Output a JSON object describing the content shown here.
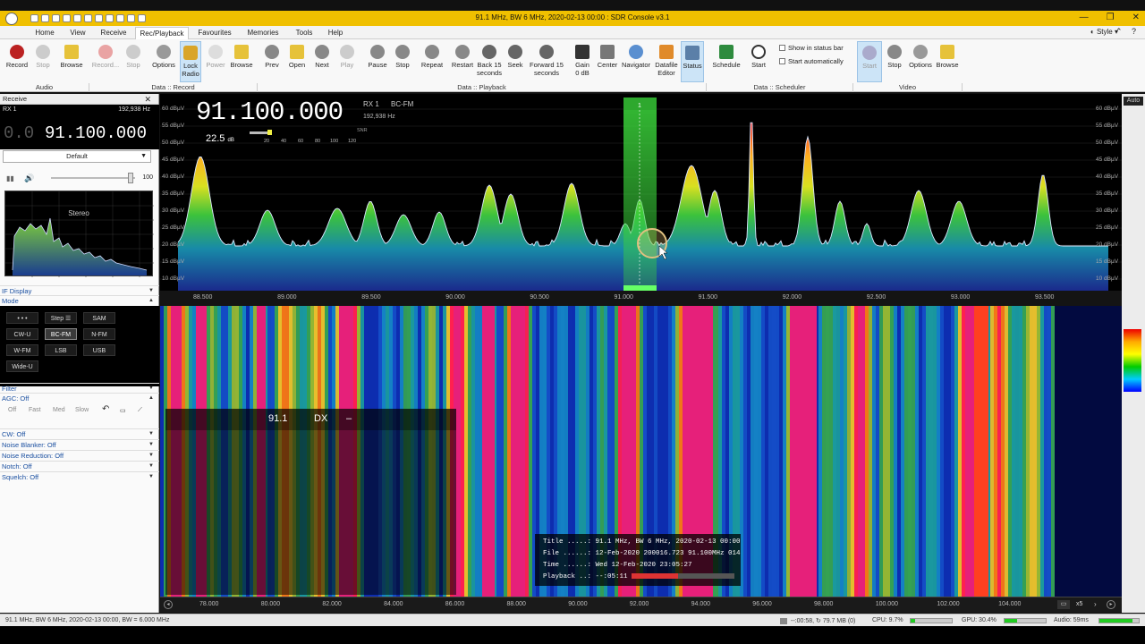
{
  "window": {
    "title": "91.1 MHz, BW 6 MHz, 2020-02-13 00:00 : SDR Console v3.1",
    "controls": [
      "—",
      "❐",
      "✕"
    ]
  },
  "menu": {
    "tabs": [
      "Home",
      "View",
      "Receive",
      "Rec/Playback",
      "Favourites",
      "Memories",
      "Tools",
      "Help"
    ],
    "active": "Rec/Playback",
    "style": "Style"
  },
  "ribbon": {
    "audio": {
      "record": "Record",
      "stop": "Stop",
      "browse": "Browse",
      "group": "Audio"
    },
    "data_record": {
      "record": "Record...",
      "stop": "Stop",
      "options": "Options",
      "lock_radio_1": "Lock",
      "lock_radio_2": "Radio",
      "power": "Power",
      "browse": "Browse",
      "group": "Data :: Record"
    },
    "data_playback": {
      "prev": "Prev",
      "open": "Open",
      "next": "Next",
      "play": "Play",
      "pause": "Pause",
      "stop": "Stop",
      "repeat": "Repeat",
      "restart": "Restart",
      "back15_1": "Back 15",
      "back15_2": "seconds",
      "seek": "Seek",
      "fwd15_1": "Forward 15",
      "fwd15_2": "seconds",
      "gain_1": "Gain",
      "gain_2": "0 dB",
      "center": "Center",
      "navigator": "Navigator",
      "datafile_1": "Datafile",
      "datafile_2": "Editor",
      "status": "Status",
      "group": "Data :: Playback"
    },
    "data_scheduler": {
      "schedule": "Schedule",
      "start": "Start",
      "show_status": "Show in status bar",
      "start_auto": "Start automatically",
      "group": "Data :: Scheduler"
    },
    "video": {
      "start": "Start",
      "stop": "Stop",
      "options": "Options",
      "browse": "Browse",
      "group": "Video"
    }
  },
  "left": {
    "receive": "Receive",
    "rx": "RX 1",
    "bw": "192,938 Hz",
    "freq_dim": "0.0",
    "freq": "91.100.000",
    "preset": "Default",
    "volume": "100",
    "stereo": "Stereo",
    "if_display": "IF Display",
    "mode": "Mode",
    "modes": [
      "• • •",
      "Step ☰",
      "SAM",
      "CW-U",
      "BC-FM",
      "N-FM",
      "W-FM",
      "LSB",
      "USB",
      "Wide-U"
    ],
    "active_mode": "BC-FM",
    "filter": "Filter",
    "agc": "AGC: Off",
    "agc_opts": [
      "Off",
      "Fast",
      "Med",
      "Slow"
    ],
    "cw": "CW: Off",
    "nb": "Noise Blanker: Off",
    "nr": "Noise Reduction: Off",
    "notch": "Notch: Off",
    "squelch": "Squelch: Off"
  },
  "spectrum": {
    "freq": "91.100.000",
    "rx": "RX 1",
    "mode": "BC-FM",
    "bw": "192,938 Hz",
    "snr_value": "22.5",
    "snr_unit": "dB",
    "snr_label": "SNR",
    "snr_ticks": [
      "20",
      "40",
      "60",
      "80",
      "100",
      "120"
    ],
    "channel_marker": "1",
    "auto": "Auto",
    "ylabels": [
      "60 dBµV",
      "55 dBµV",
      "50 dBµV",
      "45 dBµV",
      "40 dBµV",
      "35 dBµV",
      "30 dBµV",
      "25 dBµV",
      "20 dBµV",
      "15 dBµV",
      "10 dBµV"
    ],
    "ylabels_right": [
      "60 dBµV",
      "55 dBµV",
      "50 dBµV",
      "45 dBµV",
      "40 dBµV",
      "35 dBµV",
      "30 dBµV",
      "25 dBµV",
      "20 dBµV",
      "15 dBµV",
      "10 dBµV"
    ],
    "xlabels": [
      "88.500",
      "89.000",
      "89.500",
      "90.000",
      "90.500",
      "91.000",
      "91.500",
      "92.000",
      "92.500",
      "93.000",
      "93.500"
    ]
  },
  "waterfall": {
    "dx_freq": "91.1",
    "dx_label": "DX",
    "dx_dash": "–",
    "info": {
      "title": "Title .....: 91.1 MHz, BW 6 MHz, 2020-02-13 00:00",
      "file": "File ......: 12-Feb-2020 200016.723 91.100MHz 014",
      "time": "Time ......: Wed 12-Feb-2020 23:05:27",
      "playback": "Playback ..: --:05:11",
      "progress": 0.45
    },
    "xlabels": [
      "78.000",
      "80.000",
      "82.000",
      "84.000",
      "86.000",
      "88.000",
      "90.000",
      "92.000",
      "94.000",
      "96.000",
      "98.000",
      "100.000",
      "102.000",
      "104.000"
    ],
    "zoom": "x5"
  },
  "statusbar": {
    "left": "91.1 MHz, BW 6 MHz, 2020-02-13 00:00, BW = 6.000 MHz",
    "time": "--:00:58, ↻ 79.7 MB (0)",
    "cpu": "CPU: 9.7%",
    "gpu": "GPU: 30.4%",
    "audio": "Audio: 59ms"
  }
}
